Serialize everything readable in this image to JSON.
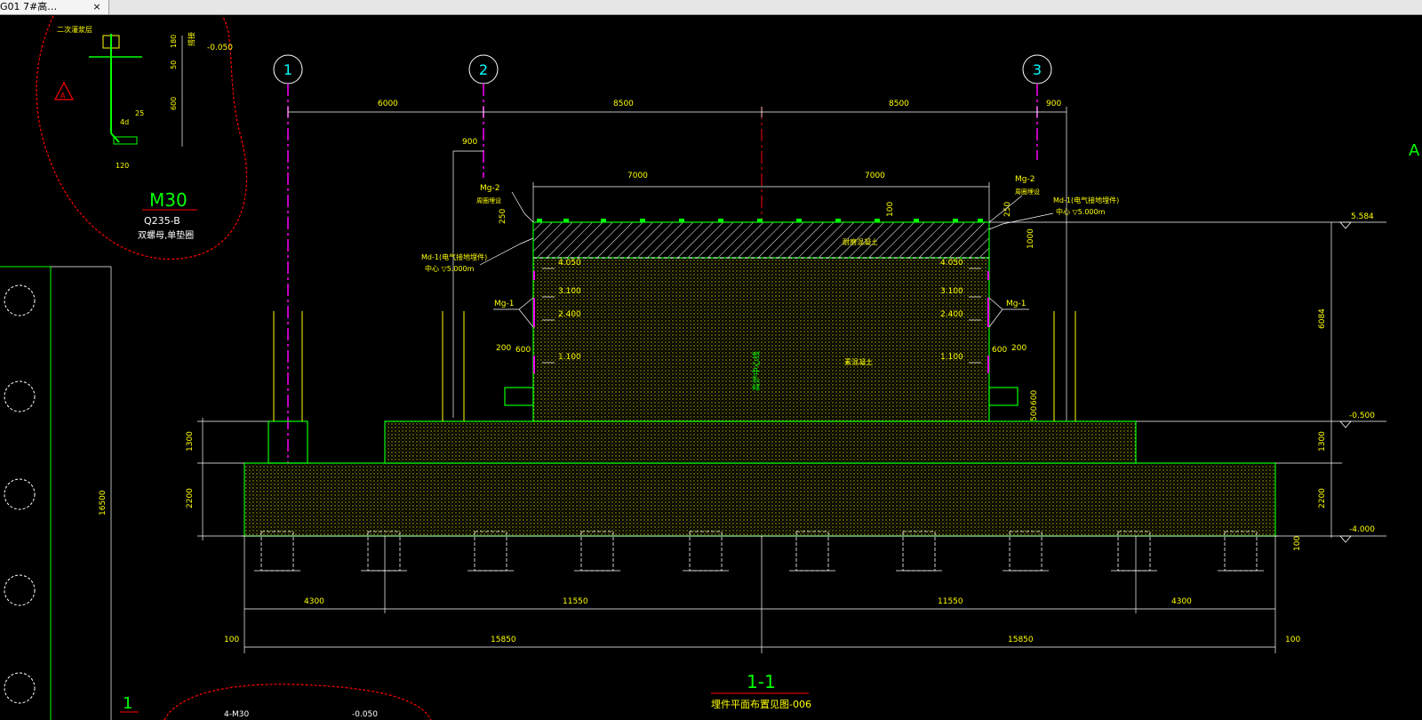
{
  "window": {
    "tab_title": "G01 7#高…",
    "tab_close": "×"
  },
  "colors": {
    "background": "#000000",
    "yellow": "#ffff00",
    "green": "#00ff00",
    "red": "#ff0000",
    "magenta": "#ff00ff",
    "white": "#ffffff",
    "cyan": "#00ffff",
    "concrete_dots": "#c8c800"
  },
  "axes": {
    "a1": "1",
    "a2": "2",
    "a3": "3"
  },
  "section": {
    "title": "1-1",
    "subtitle": "埋件平面布置见图-006"
  },
  "detail": {
    "bolt_spec": "M30",
    "material": "Q235-B",
    "nut_note": "双螺母,单垫圈",
    "grout_label": "二次灌浆层",
    "elev": "-0.050",
    "dim_180": "180",
    "dim_50": "50",
    "dim_600": "600",
    "dim_25": "25",
    "dim_120": "120",
    "dim_4d": "4d",
    "lap_mark": "搭接"
  },
  "dims": {
    "top_6000": "6000",
    "top_8500a": "8500",
    "top_8500b": "8500",
    "top_900r": "900",
    "top_900l": "900",
    "top_7000a": "7000",
    "top_7000b": "7000",
    "d4300a": "4300",
    "d11550a": "11550",
    "d11550b": "11550",
    "d4300b": "4300",
    "d15850a": "15850",
    "d15850b": "15850",
    "d100a": "100",
    "d100b": "100",
    "d100c": "100",
    "left_1300": "1300",
    "left_2200": "2200",
    "right_6084": "6084",
    "right_1300": "1300",
    "right_2200": "2200",
    "left_250": "250",
    "right_250": "250",
    "d1000": "1000",
    "d100t": "100",
    "d200l": "200",
    "d600l": "600",
    "d600r": "600",
    "d200r": "200",
    "d600v": "600",
    "d500v": "500",
    "plan_16500": "16500"
  },
  "elevations": {
    "e5584": "5.584",
    "em0500": "-0.500",
    "em4000": "-4.000",
    "e4050l": "4.050",
    "e3100l": "3.100",
    "e2400l": "2.400",
    "e1100l": "1.100",
    "e4050r": "4.050",
    "e3100r": "3.100",
    "e2400r": "2.400",
    "e1100r": "1.100"
  },
  "labels": {
    "mg2_left": "Mg-2",
    "mg2_left_note": "周圈埋设",
    "mg2_right": "Mg-2",
    "mg2_right_note": "周圈埋设",
    "md1_left": "Md-1(电气接地埋件)",
    "md1_left_center": "中心 ▽5.000m",
    "md1_right": "Md-1(电气接地埋件)",
    "md1_right_center": "中心 ▽5.000m",
    "mg1_left": "Mg-1",
    "mg1_right": "Mg-1",
    "top_concrete": "耐磨混凝土",
    "plain_concrete": "素混凝土",
    "center_axis": "高炉中心线",
    "sheet_A": "A",
    "bottom_left_num": "1",
    "bottom_bolt": "4-M30",
    "bottom_elev": "-0.050"
  }
}
